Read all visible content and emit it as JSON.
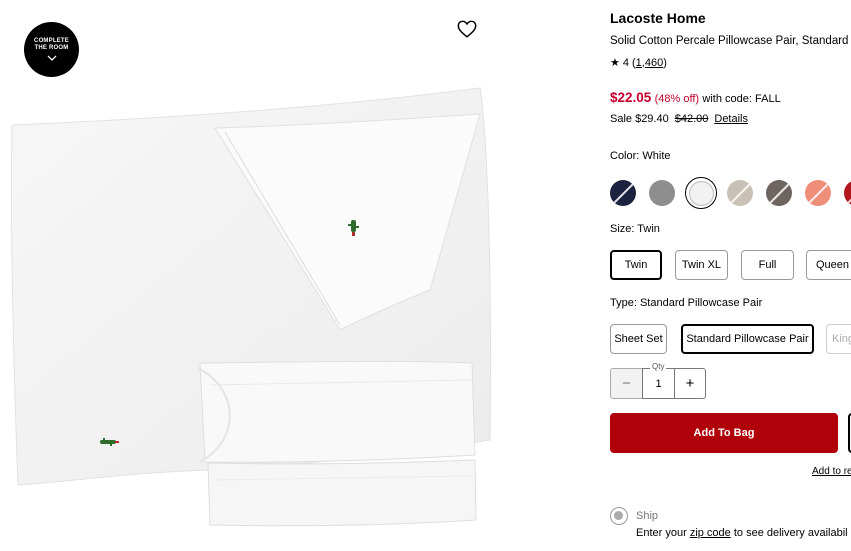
{
  "image": {
    "complete_room_line1": "COMPLETE",
    "complete_room_line2": "THE ROOM"
  },
  "product": {
    "brand": "Lacoste Home",
    "name": "Solid Cotton Percale Pillowcase Pair, Standard",
    "rating": "4",
    "review_count": "1,460",
    "sale_price": "$22.05",
    "discount": "(48% off)",
    "code_text": "with code: FALL",
    "sale_text": "Sale $29.40",
    "original_price": "$42.00",
    "details_link": "Details"
  },
  "color": {
    "label": "Color: White",
    "swatches": [
      {
        "name": "Navy",
        "hex": "#1b2240",
        "unavailable": true
      },
      {
        "name": "Gray Heather",
        "hex": "#8e8e8e",
        "unavailable": false
      },
      {
        "name": "White",
        "hex": "#f2f2f2",
        "selected": true
      },
      {
        "name": "Beige",
        "hex": "#c9c0b6",
        "unavailable": true
      },
      {
        "name": "Taupe",
        "hex": "#6e6460",
        "unavailable": true
      },
      {
        "name": "Coral",
        "hex": "#ee8e78",
        "unavailable": true
      },
      {
        "name": "Red",
        "hex": "#b0161c",
        "unavailable": true
      }
    ]
  },
  "size": {
    "label": "Size: Twin",
    "options": [
      "Twin",
      "Twin XL",
      "Full",
      "Queen"
    ],
    "selected": "Twin"
  },
  "type": {
    "label": "Type: Standard Pillowcase Pair",
    "options": [
      "Sheet Set",
      "Standard Pillowcase Pair",
      "King"
    ],
    "selected": "Standard Pillowcase Pair"
  },
  "quantity": {
    "label": "Qty",
    "value": "1",
    "minus": "−",
    "plus": "+"
  },
  "actions": {
    "add_to_bag": "Add To Bag",
    "add_to_registry": "Add to re"
  },
  "shipping": {
    "option": "Ship",
    "delivery_prefix": "Enter your ",
    "zip_link": "zip code",
    "delivery_suffix": " to see delivery availabil"
  },
  "colors": {
    "sale_red": "#c4002b",
    "button_red": "#b0000a"
  }
}
